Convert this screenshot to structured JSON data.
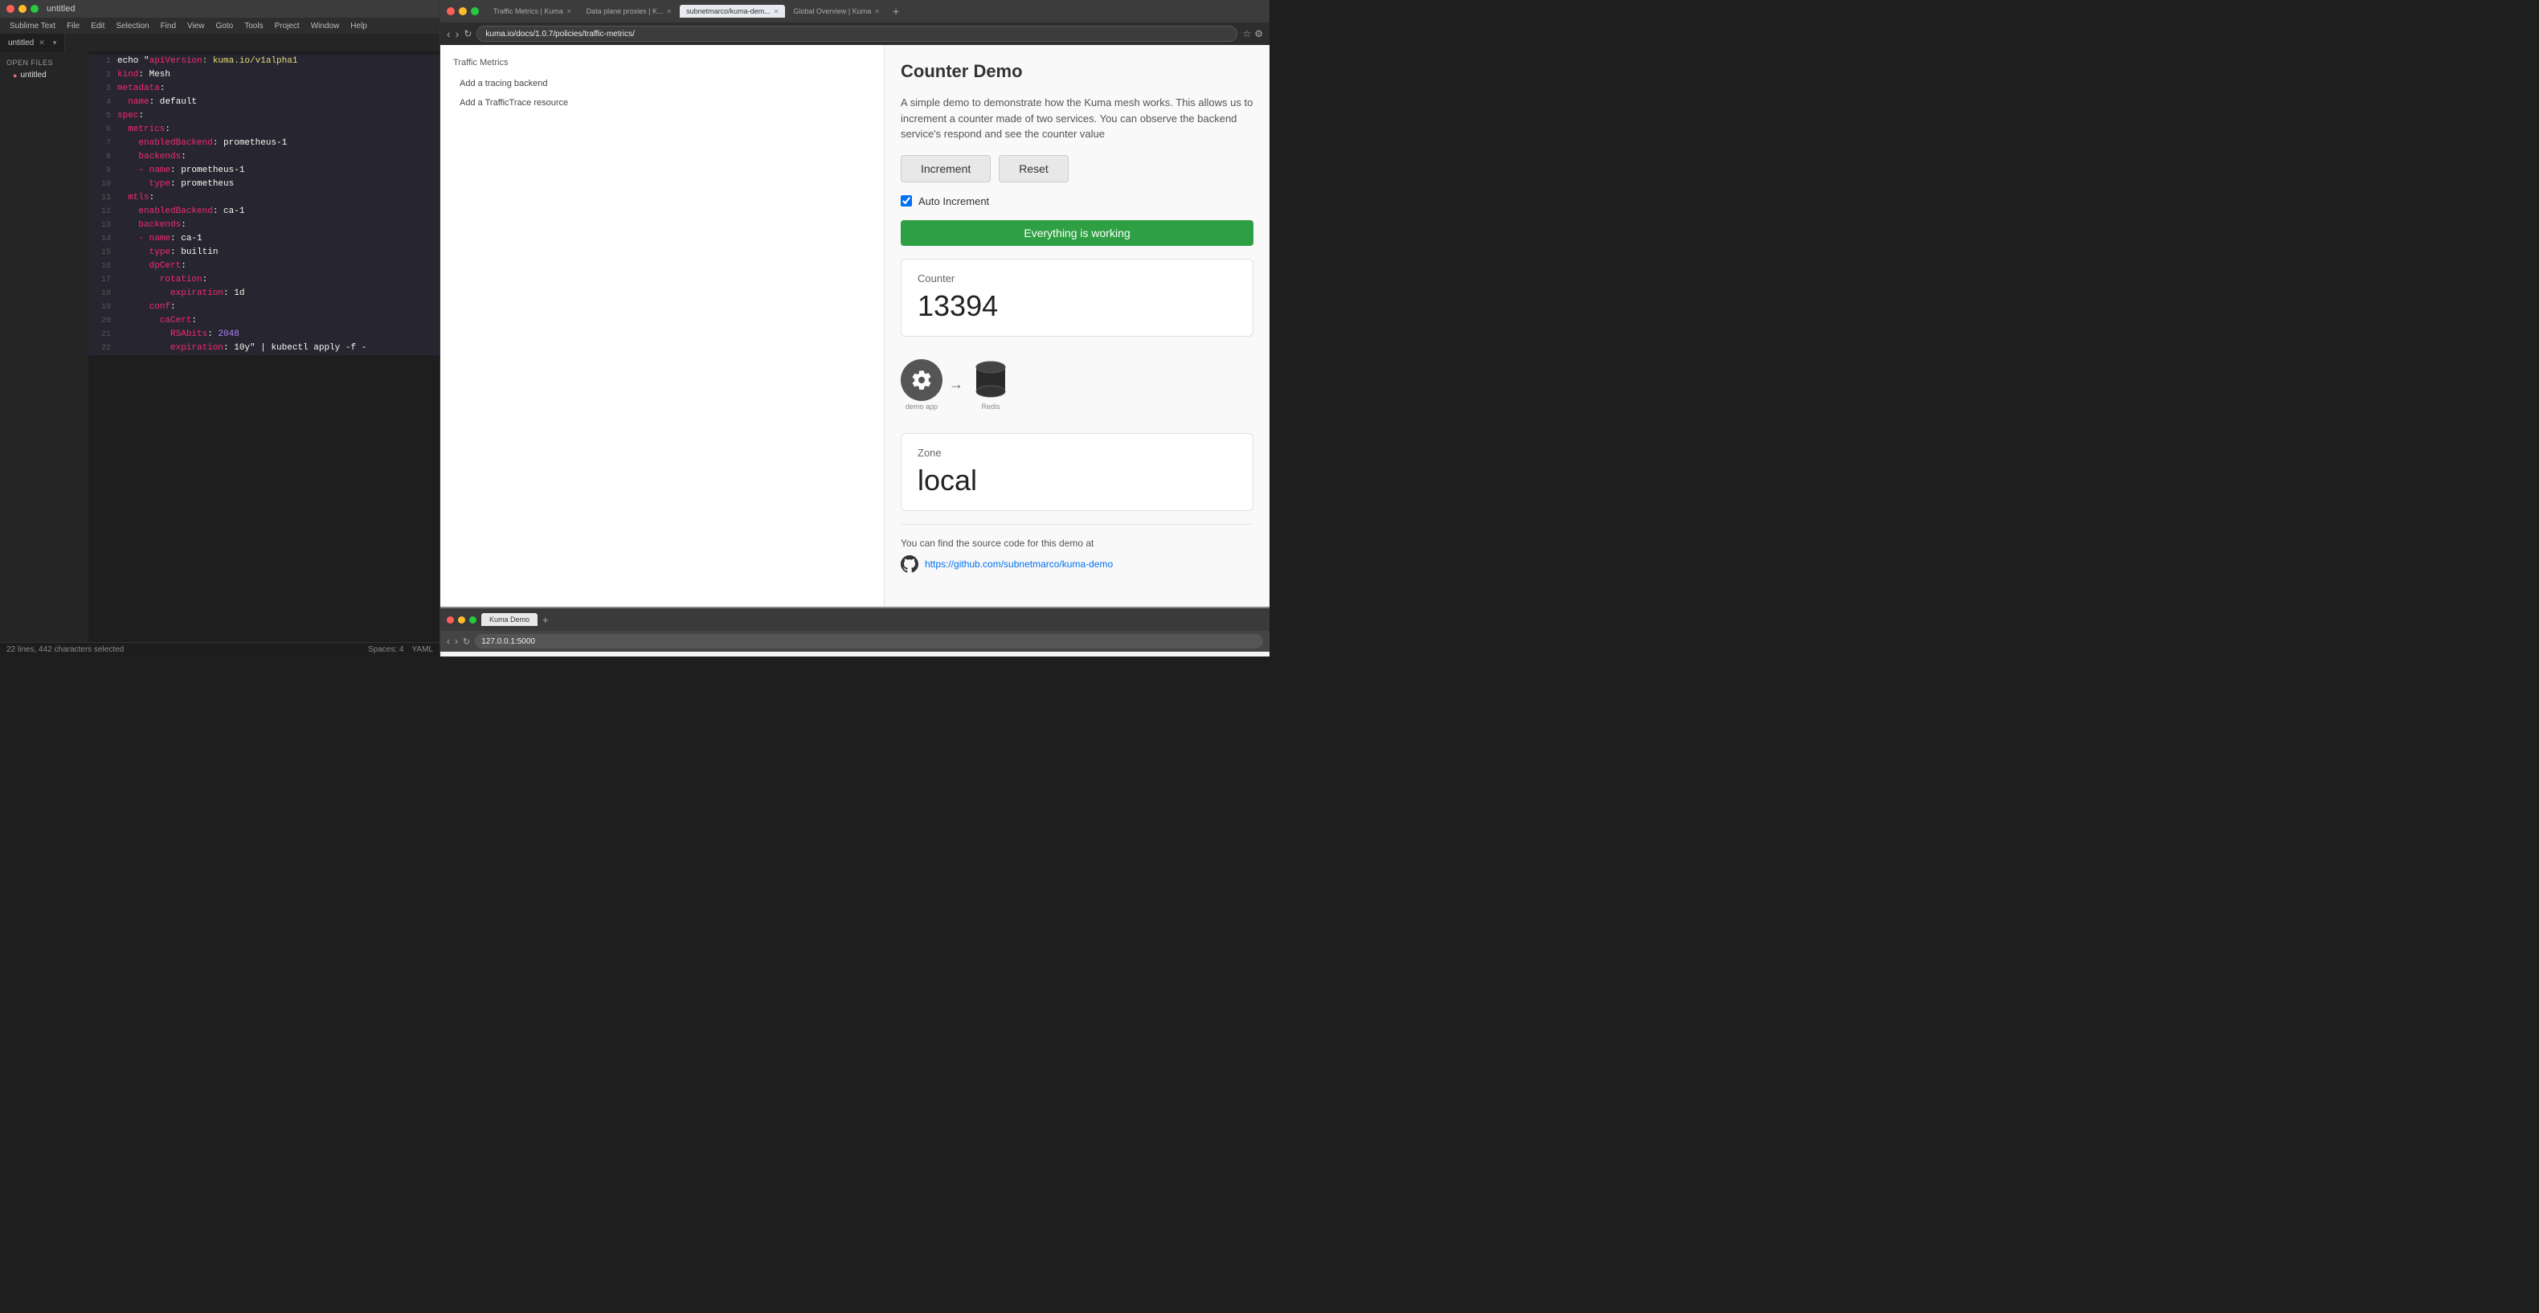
{
  "sublime": {
    "title": "untitled",
    "traffic_lights": [
      "red",
      "yellow",
      "green"
    ],
    "menu_items": [
      "Sublime Text",
      "File",
      "Edit",
      "Selection",
      "Find",
      "View",
      "Goto",
      "Tools",
      "Project",
      "Window",
      "Help"
    ],
    "tab_label": "untitled",
    "sidebar_header": "OPEN FILES",
    "sidebar_item": "untitled",
    "statusbar": {
      "lines": "22 lines, 442 characters selected",
      "spaces": "Spaces: 4",
      "syntax": "YAML"
    },
    "code_lines": [
      {
        "num": 1,
        "parts": [
          {
            "text": "echo \"",
            "cls": "c-white"
          },
          {
            "text": "apiVersion",
            "cls": "c-pink"
          },
          {
            "text": ": kuma.io/v1alpha1",
            "cls": "c-yellow"
          }
        ]
      },
      {
        "num": 2,
        "parts": [
          {
            "text": "kind",
            "cls": "c-pink"
          },
          {
            "text": ": Mesh",
            "cls": "c-white"
          }
        ]
      },
      {
        "num": 3,
        "parts": [
          {
            "text": "metadata",
            "cls": "c-pink"
          },
          {
            "text": ":",
            "cls": "c-white"
          }
        ]
      },
      {
        "num": 4,
        "parts": [
          {
            "text": "  name",
            "cls": "c-pink"
          },
          {
            "text": ": default",
            "cls": "c-white"
          }
        ]
      },
      {
        "num": 5,
        "parts": [
          {
            "text": "spec",
            "cls": "c-pink"
          },
          {
            "text": ":",
            "cls": "c-white"
          }
        ]
      },
      {
        "num": 6,
        "parts": [
          {
            "text": "  metrics",
            "cls": "c-pink"
          },
          {
            "text": ":",
            "cls": "c-white"
          }
        ]
      },
      {
        "num": 7,
        "parts": [
          {
            "text": "    enabledBackend",
            "cls": "c-pink"
          },
          {
            "text": ": prometheus-1",
            "cls": "c-white"
          }
        ]
      },
      {
        "num": 8,
        "parts": [
          {
            "text": "    backends",
            "cls": "c-pink"
          },
          {
            "text": ":",
            "cls": "c-white"
          }
        ]
      },
      {
        "num": 9,
        "parts": [
          {
            "text": "    - name",
            "cls": "c-pink"
          },
          {
            "text": ": prometheus-1",
            "cls": "c-white"
          }
        ]
      },
      {
        "num": 10,
        "parts": [
          {
            "text": "      type",
            "cls": "c-pink"
          },
          {
            "text": ": prometheus",
            "cls": "c-white"
          }
        ]
      },
      {
        "num": 11,
        "parts": [
          {
            "text": "  mtls",
            "cls": "c-pink"
          },
          {
            "text": ":",
            "cls": "c-white"
          }
        ]
      },
      {
        "num": 12,
        "parts": [
          {
            "text": "    enabledBackend",
            "cls": "c-pink"
          },
          {
            "text": ": ca-1",
            "cls": "c-white"
          }
        ]
      },
      {
        "num": 13,
        "parts": [
          {
            "text": "    backends",
            "cls": "c-pink"
          },
          {
            "text": ":",
            "cls": "c-white"
          }
        ]
      },
      {
        "num": 14,
        "parts": [
          {
            "text": "    - name",
            "cls": "c-pink"
          },
          {
            "text": ": ca-1",
            "cls": "c-white"
          }
        ]
      },
      {
        "num": 15,
        "parts": [
          {
            "text": "      type",
            "cls": "c-pink"
          },
          {
            "text": ": builtin",
            "cls": "c-white"
          }
        ]
      },
      {
        "num": 16,
        "parts": [
          {
            "text": "      dpCert",
            "cls": "c-pink"
          },
          {
            "text": ":",
            "cls": "c-white"
          }
        ]
      },
      {
        "num": 17,
        "parts": [
          {
            "text": "        rotation",
            "cls": "c-pink"
          },
          {
            "text": ":",
            "cls": "c-white"
          }
        ]
      },
      {
        "num": 18,
        "parts": [
          {
            "text": "          expiration",
            "cls": "c-pink"
          },
          {
            "text": ": 1d",
            "cls": "c-white"
          }
        ]
      },
      {
        "num": 19,
        "parts": [
          {
            "text": "      conf",
            "cls": "c-pink"
          },
          {
            "text": ":",
            "cls": "c-white"
          }
        ]
      },
      {
        "num": 20,
        "parts": [
          {
            "text": "        caCert",
            "cls": "c-pink"
          },
          {
            "text": ":",
            "cls": "c-white"
          }
        ]
      },
      {
        "num": 21,
        "parts": [
          {
            "text": "          RSAbits",
            "cls": "c-pink"
          },
          {
            "text": ": ",
            "cls": "c-white"
          },
          {
            "text": "2048",
            "cls": "c-purple"
          }
        ]
      },
      {
        "num": 22,
        "parts": [
          {
            "text": "          expiration",
            "cls": "c-pink"
          },
          {
            "text": ": 10y\" | kubectl apply -f -",
            "cls": "c-white"
          }
        ]
      }
    ]
  },
  "browser1": {
    "tabs": [
      {
        "label": "Traffic Metrics | Kuma",
        "active": false
      },
      {
        "label": "Data plane proxies | K...",
        "active": false
      },
      {
        "label": "subnetmarco/kuma-dem...",
        "active": true
      },
      {
        "label": "Global Overview | Kuma",
        "active": false
      }
    ],
    "url": "kuma.io/docs/1.0.7/policies/traffic-metrics/"
  },
  "browser2": {
    "tabs": [
      {
        "label": "Kuma Demo",
        "active": true
      }
    ],
    "url": "127.0.0.1:5000"
  },
  "counter_demo": {
    "title": "Counter Demo",
    "description_lines": [
      "A simple demo",
      "to demonstrate how the",
      "Kuma mesh works. This",
      "allows us to increment a",
      "counter made of two"
    ],
    "description": "A simple demo to demonstrate how the Kuma mesh works. This allows us to increment a counter made of two services. You can observe the backend service's respond and see the counter value",
    "increment_label": "Increment",
    "reset_label": "Reset",
    "auto_increment_label": "Auto Increment",
    "status_text": "Everything is working",
    "counter_label": "Counter",
    "counter_value": "13394",
    "zone_label": "Zone",
    "zone_value": "local",
    "source_text": "You can find the source code for this demo at",
    "github_url": "https://github.com/subnetmarco/kuma-demo",
    "arch_labels": {
      "demo_app": "demo app",
      "redis": "Redis"
    }
  },
  "kuma_page": {
    "nav_items": [
      "Add a tracing backend",
      "Add a TrafficTrace resource"
    ]
  }
}
